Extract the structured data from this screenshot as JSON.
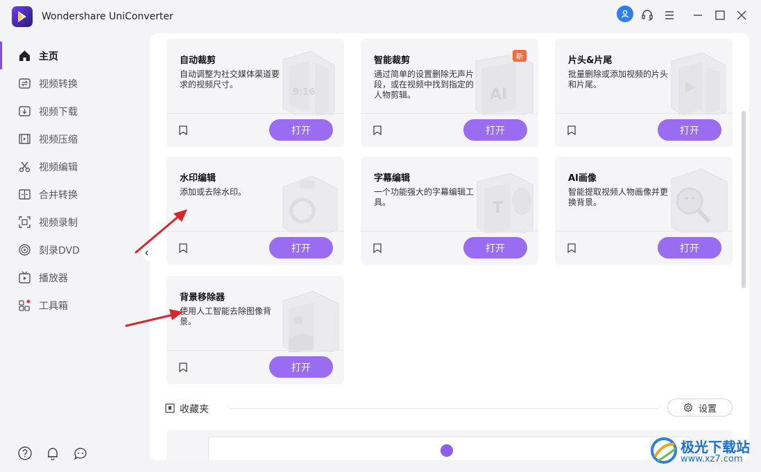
{
  "app": {
    "title": "Wondershare UniConverter"
  },
  "sidebar": {
    "items": [
      {
        "label": "主页",
        "icon": "home-icon",
        "active": true
      },
      {
        "label": "视频转换",
        "icon": "convert-icon"
      },
      {
        "label": "视频下载",
        "icon": "download-icon"
      },
      {
        "label": "视频压缩",
        "icon": "compress-icon"
      },
      {
        "label": "视频编辑",
        "icon": "scissors-icon"
      },
      {
        "label": "合并转换",
        "icon": "merge-icon"
      },
      {
        "label": "视频录制",
        "icon": "record-icon"
      },
      {
        "label": "刻录DVD",
        "icon": "dvd-icon"
      },
      {
        "label": "播放器",
        "icon": "player-icon"
      },
      {
        "label": "工具箱",
        "icon": "toolbox-icon"
      }
    ]
  },
  "cards": [
    {
      "title": "自动裁剪",
      "desc": "自动调整为社交媒体渠道要求的视频尺寸。",
      "button": "打开",
      "art_text": "9:16"
    },
    {
      "title": "智能裁剪",
      "desc": "通过简单的设置删除无声片段，或在视频中找到指定的人物剪辑。",
      "button": "打开",
      "badge": "新",
      "art_text": "AI"
    },
    {
      "title": "片头&片尾",
      "desc": "批量删除或添加视频的片头和片尾。",
      "button": "打开"
    },
    {
      "title": "水印编辑",
      "desc": "添加或去除水印。",
      "button": "打开"
    },
    {
      "title": "字幕编辑",
      "desc": "一个功能强大的字幕编辑工具。",
      "button": "打开",
      "art_text": "T"
    },
    {
      "title": "AI画像",
      "desc": "智能提取视频人物画像并更换背景。",
      "button": "打开"
    },
    {
      "title": "背景移除器",
      "desc": "使用人工智能去除图像背景。",
      "button": "打开"
    }
  ],
  "favorites": {
    "label": "收藏夹",
    "settings": "设置"
  },
  "watermark": {
    "name": "极光下载站",
    "url": "www.xz7.com"
  },
  "colors": {
    "accent": "#9a6cf2",
    "badge": "#f86a3a",
    "user": "#2e7cf6",
    "arrow": "#d9262b"
  }
}
